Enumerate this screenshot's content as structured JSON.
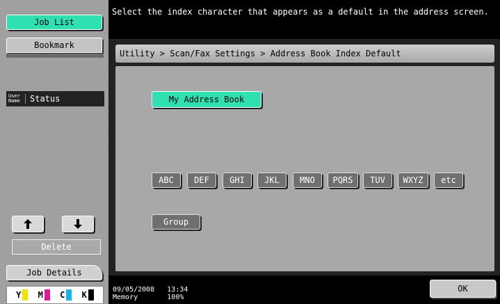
{
  "left_panel": {
    "job_list_label": "Job List",
    "bookmark_label": "Bookmark",
    "user_name_header": "User Name",
    "status_header": "Status",
    "up_arrow": "🡅",
    "down_arrow": "🡇",
    "delete_label": "Delete",
    "job_details_label": "Job Details",
    "toner": [
      {
        "letter": "Y",
        "color": "#f2e600"
      },
      {
        "letter": "M",
        "color": "#e0199b"
      },
      {
        "letter": "C",
        "color": "#19b4e6"
      },
      {
        "letter": "K",
        "color": "#000000"
      }
    ]
  },
  "message": "Select the index character that appears as a default in the address screen.",
  "breadcrumb": "Utility > Scan/Fax Settings > Address Book Index Default",
  "my_address_book_label": "My Address Book",
  "index_buttons": [
    "ABC",
    "DEF",
    "GHI",
    "JKL",
    "MNO",
    "PQRS",
    "TUV",
    "WXYZ",
    "etc"
  ],
  "group_label": "Group",
  "footer": {
    "date": "09/05/2008",
    "time": "13:34",
    "memory_label": "Memory",
    "memory_value": "100%",
    "ok_label": "OK"
  },
  "colors": {
    "accent": "#2fe0b0",
    "panel_gray": "#a8a8a8",
    "index_button": "#707070"
  }
}
